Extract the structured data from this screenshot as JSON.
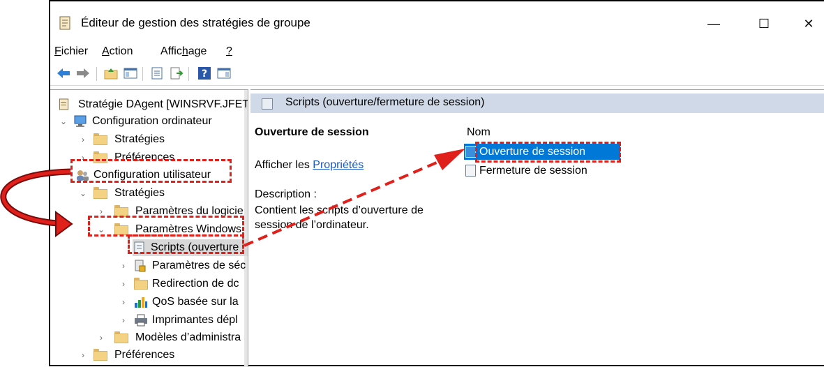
{
  "window": {
    "title": "Éditeur de gestion des stratégies de groupe",
    "controls": {
      "minimize": "—",
      "maximize": "☐",
      "close": "✕"
    }
  },
  "menu": {
    "fichier": {
      "pre": "",
      "key": "F",
      "post": "ichier"
    },
    "action": {
      "pre": "",
      "key": "A",
      "post": "ction"
    },
    "affichage": {
      "pre": "Affic",
      "key": "h",
      "post": "age"
    },
    "help": {
      "pre": "",
      "key": "?",
      "post": ""
    }
  },
  "toolbar": {
    "icons": [
      "back-arrow-icon",
      "forward-arrow-icon",
      "up-folder-icon",
      "show-hide-tree-icon",
      "properties-icon",
      "export-list-icon",
      "help-icon",
      "action-pane-icon"
    ]
  },
  "tree": {
    "items": [
      {
        "label": "Stratégie DAgent [WINSRVF.JFET",
        "icon": "policy-document-icon"
      },
      {
        "label": "Configuration ordinateur",
        "icon": "computer-icon"
      },
      {
        "label": "Stratégies",
        "icon": "folder-icon"
      },
      {
        "label": "Préférences",
        "icon": "folder-icon"
      },
      {
        "label": "Configuration utilisateur",
        "icon": "users-icon"
      },
      {
        "label": "Stratégies",
        "icon": "folder-icon"
      },
      {
        "label": "Paramètres du logicie",
        "icon": "folder-icon"
      },
      {
        "label": "Paramètres Windows",
        "icon": "folder-icon"
      },
      {
        "label": "Scripts (ouverture",
        "icon": "script-icon"
      },
      {
        "label": "Paramètres de séc",
        "icon": "security-settings-icon"
      },
      {
        "label": "Redirection de dc",
        "icon": "folder-icon"
      },
      {
        "label": "QoS basée sur la",
        "icon": "qos-bar-chart-icon"
      },
      {
        "label": "Imprimantes dépl",
        "icon": "printer-icon"
      },
      {
        "label": "Modèles d’administra",
        "icon": "folder-icon"
      },
      {
        "label": "Préférences",
        "icon": "folder-icon"
      }
    ]
  },
  "main": {
    "header": "Scripts (ouverture/fermeture de session)",
    "extended": {
      "title": "Ouverture de session",
      "link_prefix": "Afficher les ",
      "link_text": "Propriétés",
      "description_label": "Description :",
      "description": "Contient les scripts d’ouverture de session de l’ordinateur."
    },
    "list": {
      "column_name": "Nom",
      "items": [
        {
          "label": "Ouverture de session",
          "selected": true
        },
        {
          "label": "Fermeture de session",
          "selected": false
        }
      ]
    }
  },
  "annotations": {
    "color": "#e0201b"
  }
}
